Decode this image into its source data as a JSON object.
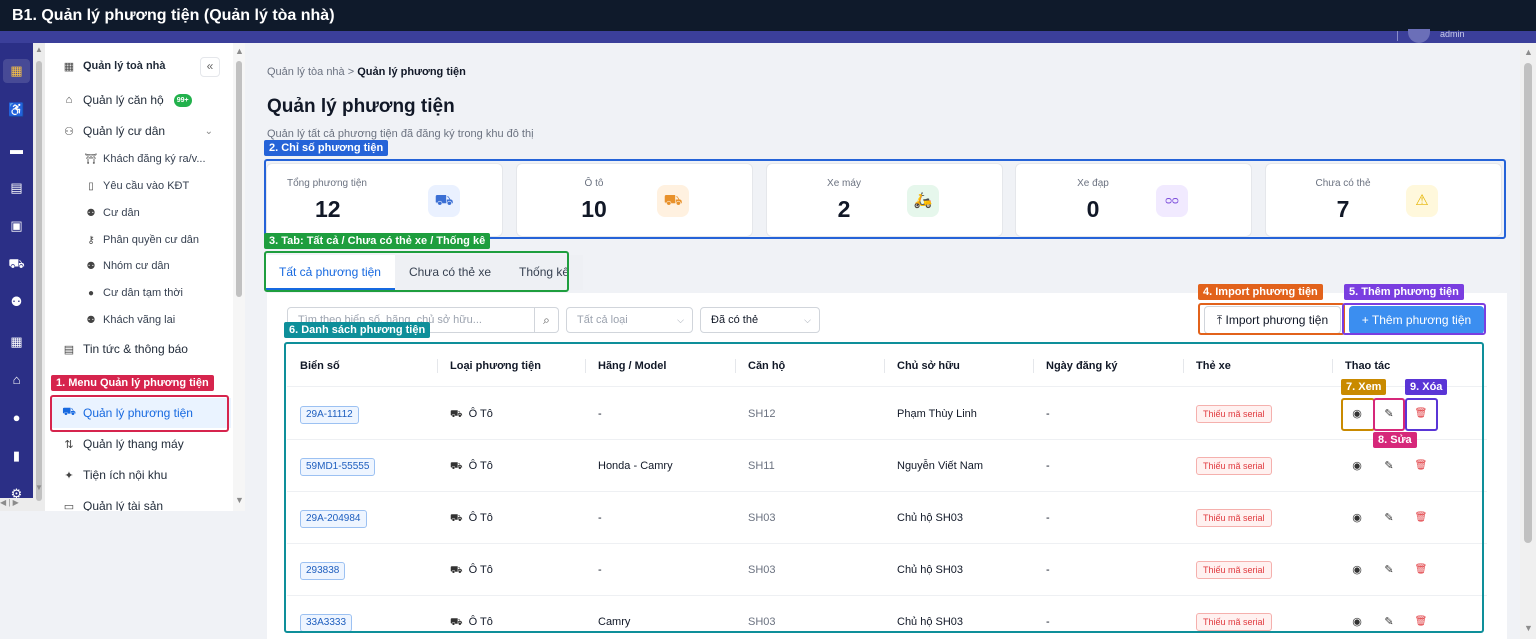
{
  "window": {
    "title": "B1. Quản lý phương tiện (Quản lý tòa nhà)",
    "user": "admin"
  },
  "rail_icons": [
    "building-icon",
    "pram-icon",
    "chat-icon",
    "calculator-icon",
    "briefcase-icon",
    "car-icon",
    "users-icon",
    "building-grid-icon",
    "store-icon",
    "person-icon",
    "bar-chart-icon",
    "gear-icon"
  ],
  "sidebar": {
    "collapse": "«",
    "items": [
      {
        "label": "Quản lý toà nhà",
        "icon": "building-icon",
        "glyph": "▦"
      },
      {
        "label": "Quản lý căn hộ",
        "icon": "home-icon",
        "glyph": "⌂",
        "badge": "99+"
      },
      {
        "label": "Quản lý cư dân",
        "icon": "residents-icon",
        "glyph": "⚇",
        "chevron": "⌄"
      },
      {
        "label": "Khách đăng ký ra/v...",
        "icon": "gate-icon",
        "glyph": "⛩"
      },
      {
        "label": "Yêu cầu vào KĐT",
        "icon": "phone-icon",
        "glyph": "▯"
      },
      {
        "label": "Cư dân",
        "icon": "people-icon",
        "glyph": "⚉"
      },
      {
        "label": "Phân quyền cư dân",
        "icon": "key-icon",
        "glyph": "⚷"
      },
      {
        "label": "Nhóm cư dân",
        "icon": "group-icon",
        "glyph": "⚉"
      },
      {
        "label": "Cư dân tạm thời",
        "icon": "user-icon",
        "glyph": "●"
      },
      {
        "label": "Khách vãng lai",
        "icon": "visitors-icon",
        "glyph": "⚉"
      },
      {
        "label": "Tin tức & thông báo",
        "icon": "news-icon",
        "glyph": "▤"
      },
      {
        "label": "Quản lý phương tiện",
        "icon": "car-icon",
        "glyph": "⛟"
      },
      {
        "label": "Quản lý thang máy",
        "icon": "elevator-icon",
        "glyph": "⇅"
      },
      {
        "label": "Tiện ích nội khu",
        "icon": "amenity-icon",
        "glyph": "✦"
      },
      {
        "label": "Quản lý tài sản",
        "icon": "assets-icon",
        "glyph": "▭"
      }
    ]
  },
  "breadcrumb": {
    "parent": "Quản lý tòa nhà",
    "sep": " > ",
    "current": "Quản lý phương tiện"
  },
  "page": {
    "title": "Quản lý phương tiện",
    "subtitle": "Quản lý tất cả phương tiện đã đăng ký trong khu đô thị"
  },
  "stats": [
    {
      "label": "Tổng phương tiện",
      "value": "12",
      "icon": "car-icon",
      "glyph": "⛟",
      "color": "#3b6fd4",
      "bg": "#eaf1ff"
    },
    {
      "label": "Ô tô",
      "value": "10",
      "icon": "car-icon",
      "glyph": "⛟",
      "color": "#e8912b",
      "bg": "#fff1e0"
    },
    {
      "label": "Xe máy",
      "value": "2",
      "icon": "scooter-icon",
      "glyph": "🛵",
      "color": "#22a34a",
      "bg": "#e6f7ec"
    },
    {
      "label": "Xe đạp",
      "value": "0",
      "icon": "bicycle-icon",
      "glyph": "ᴑᴑ",
      "color": "#7c4ddb",
      "bg": "#f1eaff"
    },
    {
      "label": "Chưa có thẻ",
      "value": "7",
      "icon": "warning-icon",
      "glyph": "⚠",
      "color": "#e5b400",
      "bg": "#fff8dc"
    }
  ],
  "tabs": [
    "Tất cả phương tiện",
    "Chưa có thẻ xe",
    "Thống kê"
  ],
  "filters": {
    "search_placeholder": "Tìm theo biển số, hãng, chủ sở hữu...",
    "type_placeholder": "Tất cả loại",
    "card_value": "Đã có thẻ"
  },
  "buttons": {
    "import": "⤒  Import phương tiện",
    "add": "+  Thêm phương tiện"
  },
  "table": {
    "columns": [
      "Biển số",
      "Loại phương tiện",
      "Hãng / Model",
      "Căn hộ",
      "Chủ sở hữu",
      "Ngày đăng ký",
      "Thẻ xe",
      "Thao tác"
    ],
    "rows": [
      {
        "plate": "29A-11112",
        "type": "Ô Tô",
        "model": "-",
        "unit": "SH12",
        "owner": "Phạm Thùy Linh",
        "date": "-",
        "card": "Thiếu mã serial"
      },
      {
        "plate": "59MD1-55555",
        "type": "Ô Tô",
        "model": "Honda - Camry",
        "unit": "SH11",
        "owner": "Nguyễn Viết Nam",
        "date": "-",
        "card": "Thiếu mã serial"
      },
      {
        "plate": "29A-204984",
        "type": "Ô Tô",
        "model": "-",
        "unit": "SH03",
        "owner": "Chủ hộ SH03",
        "date": "-",
        "card": "Thiếu mã serial"
      },
      {
        "plate": "293838",
        "type": "Ô Tô",
        "model": "-",
        "unit": "SH03",
        "owner": "Chủ hộ SH03",
        "date": "-",
        "card": "Thiếu mã serial"
      },
      {
        "plate": "33A3333",
        "type": "Ô Tô",
        "model": "Camry",
        "unit": "SH03",
        "owner": "Chủ hộ SH03",
        "date": "-",
        "card": "Thiếu mã serial"
      }
    ]
  },
  "annotations": [
    {
      "label": "1. Menu Quản lý phương tiện",
      "color": "#d6244d"
    },
    {
      "label": "2. Chỉ số phương tiện",
      "color": "#2563d8"
    },
    {
      "label": "3. Tab: Tất cả / Chưa có thẻ xe / Thống kê",
      "color": "#1e9e3e"
    },
    {
      "label": "4. Import phương tiện",
      "color": "#e2621b"
    },
    {
      "label": "5. Thêm phương tiện",
      "color": "#7a3ee0"
    },
    {
      "label": "6. Danh sách phương tiện",
      "color": "#0e8f9a"
    },
    {
      "label": "7. Xem",
      "color": "#c98a00"
    },
    {
      "label": "8. Sửa",
      "color": "#d6287a"
    },
    {
      "label": "9. Xóa",
      "color": "#5a35d6"
    }
  ]
}
